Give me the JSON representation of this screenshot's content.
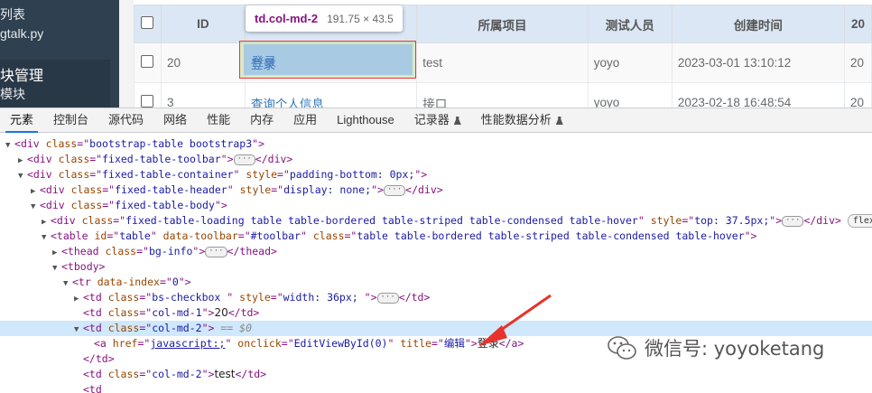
{
  "sidebar": {
    "line1": "列表",
    "line2": "gtalk.py",
    "section_title": "块管理",
    "sub_item": "模块"
  },
  "table": {
    "headers": [
      "",
      "ID",
      "",
      "所属项目",
      "测试人员",
      "创建时间",
      "20"
    ],
    "rows": [
      {
        "id": "20",
        "name": "登录",
        "project": "test",
        "tester": "yoyo",
        "created": "2023-03-01 13:10:12",
        "extra": "20"
      },
      {
        "id": "3",
        "name": "查询个人信息",
        "project": "接口",
        "tester": "yoyo",
        "created": "2023-02-18 16:48:54",
        "extra": "20"
      }
    ]
  },
  "tooltip": {
    "selector": "td.col-md-2",
    "size": "191.75 × 43.5"
  },
  "devtools": {
    "tabs": [
      {
        "label": "元素",
        "active": true
      },
      {
        "label": "控制台"
      },
      {
        "label": "源代码"
      },
      {
        "label": "网络"
      },
      {
        "label": "性能"
      },
      {
        "label": "内存"
      },
      {
        "label": "应用"
      },
      {
        "label": "Lighthouse"
      },
      {
        "label": "记录器",
        "flask": true
      },
      {
        "label": "性能数据分析",
        "flask": true
      }
    ],
    "dom": {
      "l1_tag": "div",
      "l1_attr_v": "bootstrap-table bootstrap3",
      "l2_v": "fixed-table-toolbar",
      "l3_v1": "fixed-table-container",
      "l3_v2": "padding-bottom: 0px;",
      "l4_v1": "fixed-table-header",
      "l4_v2": "display: none;",
      "l5_v": "fixed-table-body",
      "l6_v1": "fixed-table-loading table table-bordered table-striped table-condensed table-hover",
      "l6_v2": "top: 37.5px;",
      "l6_badge": "flex",
      "l7_v1": "table",
      "l7_v2": "#toolbar",
      "l7_v3": "table table-bordered table-striped table-condensed table-hover",
      "l8_v": "bg-info",
      "l10_v": "0",
      "l11_v1": "bs-checkbox ",
      "l11_v2": "width: 36px; ",
      "l12_v": "col-md-1",
      "l12_text": "20",
      "l13_v": "col-md-2",
      "l13_eq": "== $0",
      "l14_href": "javascript:;",
      "l14_onclick": "EditViewById(0)",
      "l14_title": "编辑",
      "l14_text": "登录",
      "l16_v": "col-md-2",
      "l16_text": "test"
    }
  },
  "watermark": {
    "text": "微信号: yoyoketang"
  }
}
